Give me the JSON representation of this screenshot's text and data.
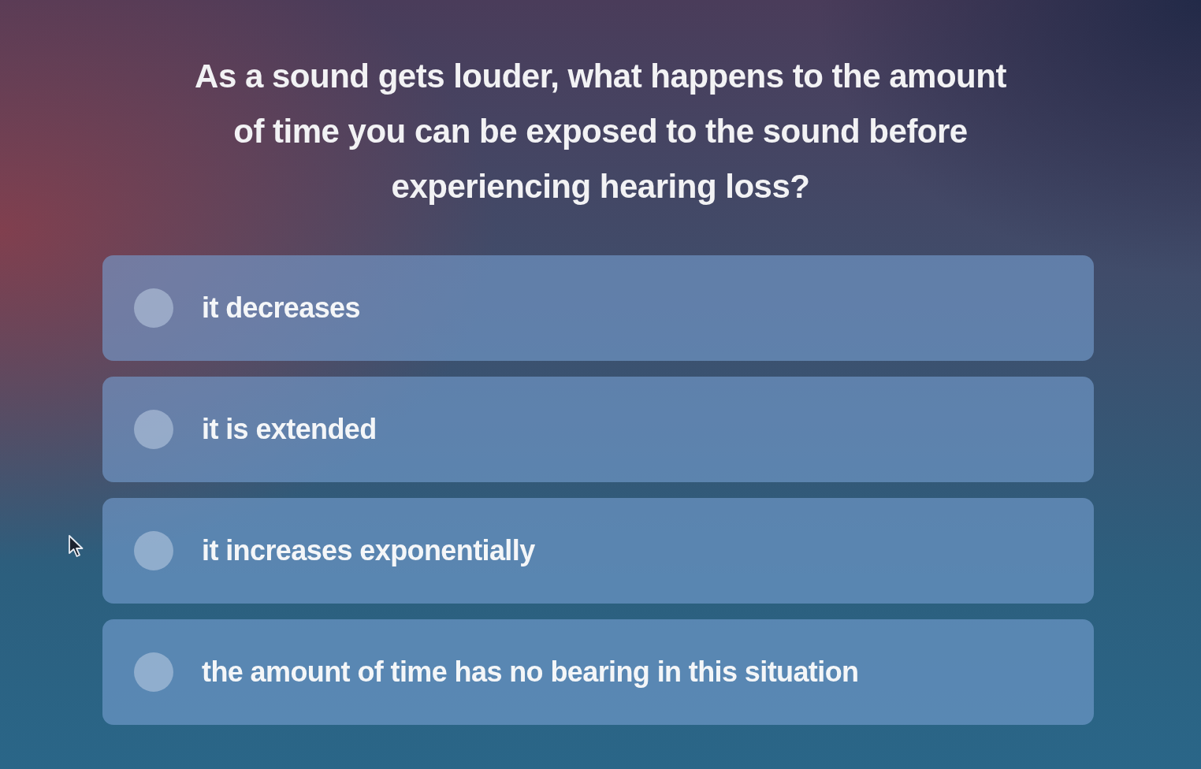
{
  "question": "As a sound gets louder, what happens to the amount of time you can be exposed to the sound before experiencing hearing loss?",
  "options": [
    {
      "label": "it decreases",
      "selected": false
    },
    {
      "label": "it is extended",
      "selected": false
    },
    {
      "label": "it increases exponentially",
      "selected": false
    },
    {
      "label": "the amount of time has no bearing in this situation",
      "selected": false
    }
  ]
}
